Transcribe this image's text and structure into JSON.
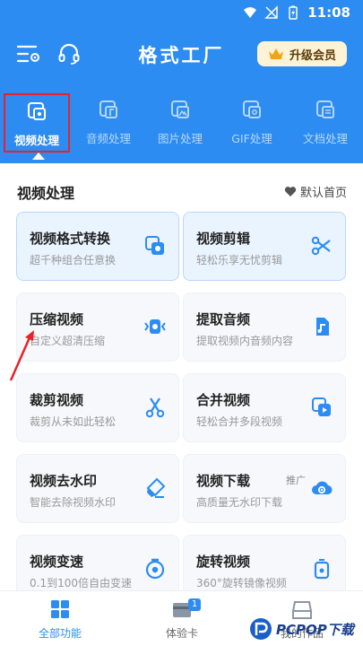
{
  "status_bar": {
    "time": "11:08"
  },
  "header": {
    "title": "格式工厂",
    "vip_label": "升级会员"
  },
  "tabs": [
    {
      "label": "视频处理",
      "active": true
    },
    {
      "label": "音频处理",
      "active": false
    },
    {
      "label": "图片处理",
      "active": false
    },
    {
      "label": "GIF处理",
      "active": false
    },
    {
      "label": "文档处理",
      "active": false
    }
  ],
  "section": {
    "title": "视频处理",
    "default_home": "默认首页"
  },
  "cards": [
    {
      "title": "视频格式转换",
      "sub": "超千种组合任意换",
      "icon": "video-convert-icon",
      "highlight": true
    },
    {
      "title": "视频剪辑",
      "sub": "轻松乐享无忧剪辑",
      "icon": "scissors-icon",
      "highlight": true
    },
    {
      "title": "压缩视频",
      "sub": "自定义超清压缩",
      "icon": "compress-icon",
      "highlight": false
    },
    {
      "title": "提取音频",
      "sub": "提取视频内音频内容",
      "icon": "audio-file-icon",
      "highlight": false
    },
    {
      "title": "裁剪视频",
      "sub": "裁剪从未如此轻松",
      "icon": "cut-icon",
      "highlight": false
    },
    {
      "title": "合并视频",
      "sub": "轻松合并多段视频",
      "icon": "merge-icon",
      "highlight": false
    },
    {
      "title": "视频去水印",
      "sub": "智能去除视频水印",
      "icon": "eraser-icon",
      "highlight": false
    },
    {
      "title": "视频下载",
      "sub": "高质量无水印下载",
      "icon": "cloud-download-icon",
      "highlight": false,
      "promo": "推广"
    },
    {
      "title": "视频变速",
      "sub": "0.1到100倍自由变速",
      "icon": "speed-icon",
      "highlight": false
    },
    {
      "title": "旋转视频",
      "sub": "360°旋转镜像视频",
      "icon": "rotate-icon",
      "highlight": false
    }
  ],
  "bottom_nav": [
    {
      "label": "全部功能",
      "active": true
    },
    {
      "label": "体验卡",
      "active": false,
      "badge": "1"
    },
    {
      "label": "我的作品",
      "active": false
    }
  ],
  "watermark": {
    "text": "PCPOP下载"
  },
  "colors": {
    "primary": "#2c8cf2",
    "highlight_red": "#e8222a",
    "vip_bg": "#fff3d6"
  }
}
